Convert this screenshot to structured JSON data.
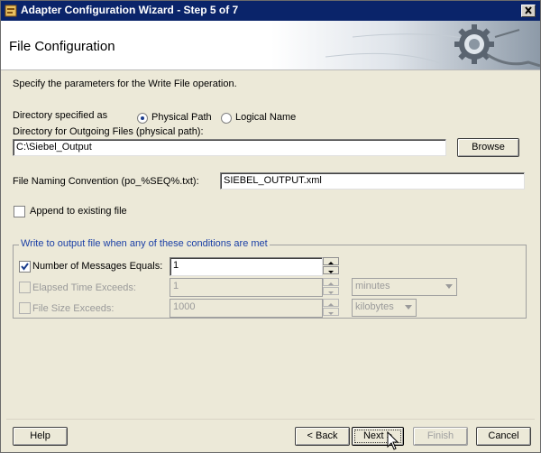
{
  "window": {
    "title": "Adapter Configuration Wizard - Step 5 of 7"
  },
  "header": {
    "title": "File Configuration"
  },
  "intro": "Specify the parameters for the Write File operation.",
  "directory_specified": {
    "label": "Directory specified as",
    "options": [
      "Physical Path",
      "Logical Name"
    ],
    "selected": "Physical Path"
  },
  "outgoing_dir": {
    "label": "Directory for Outgoing Files (physical path):",
    "value": "C:\\Siebel_Output",
    "browse_label": "Browse"
  },
  "file_naming": {
    "label": "File Naming Convention (po_%SEQ%.txt):",
    "value": "SIEBEL_OUTPUT.xml"
  },
  "append": {
    "label": "Append to existing file",
    "checked": false
  },
  "conditions": {
    "legend": "Write to output file when any of these conditions are met",
    "messages": {
      "label": "Number of Messages Equals:",
      "checked": true,
      "value": "1"
    },
    "elapsed": {
      "label": "Elapsed Time Exceeds:",
      "checked": false,
      "value": "1",
      "unit": "minutes"
    },
    "filesize": {
      "label": "File Size Exceeds:",
      "checked": false,
      "value": "1000",
      "unit": "kilobytes"
    }
  },
  "footer": {
    "help": "Help",
    "back": "< Back",
    "next": "Next >",
    "finish": "Finish",
    "cancel": "Cancel"
  }
}
